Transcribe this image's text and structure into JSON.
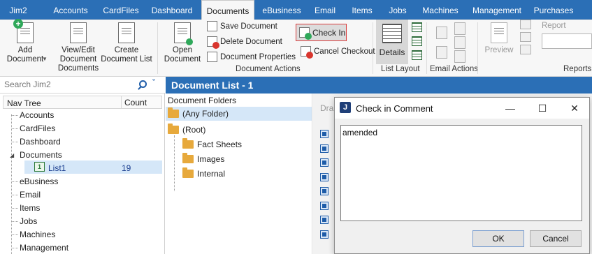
{
  "menubar": {
    "tabs": [
      {
        "label": "Jim2",
        "active": false
      },
      {
        "label": "Accounts",
        "active": false
      },
      {
        "label": "CardFiles",
        "active": false
      },
      {
        "label": "Dashboard",
        "active": false
      },
      {
        "label": "Documents",
        "active": true
      },
      {
        "label": "eBusiness",
        "active": false
      },
      {
        "label": "Email",
        "active": false
      },
      {
        "label": "Items",
        "active": false
      },
      {
        "label": "Jobs",
        "active": false
      },
      {
        "label": "Machines",
        "active": false
      },
      {
        "label": "Management",
        "active": false
      },
      {
        "label": "Purchases",
        "active": false
      }
    ]
  },
  "ribbon": {
    "add_document": "Add\nDocument",
    "view_edit": "View/Edit\nDocument\nDocuments",
    "create_list": "Create\nDocument List",
    "open_document": "Open\nDocument",
    "save_document": "Save Document",
    "delete_document": "Delete Document",
    "document_properties": "Document Properties",
    "check_in": "Check In",
    "cancel_checkout": "Cancel Checkout",
    "details": "Details",
    "preview": "Preview",
    "report": "Report",
    "groups": {
      "document_actions": "Document Actions",
      "list_layout": "List Layout",
      "email_actions": "Email Actions",
      "reports": "Reports"
    }
  },
  "search": {
    "placeholder": "Search Jim2"
  },
  "navtree": {
    "col_name": "Nav Tree",
    "col_count": "Count",
    "items": [
      {
        "label": "Accounts",
        "count": ""
      },
      {
        "label": "CardFiles",
        "count": ""
      },
      {
        "label": "Dashboard",
        "count": ""
      },
      {
        "label": "Documents",
        "count": ""
      },
      {
        "label": "List1",
        "count": "19"
      },
      {
        "label": "eBusiness",
        "count": ""
      },
      {
        "label": "Email",
        "count": ""
      },
      {
        "label": "Items",
        "count": ""
      },
      {
        "label": "Jobs",
        "count": ""
      },
      {
        "label": "Machines",
        "count": ""
      },
      {
        "label": "Management",
        "count": ""
      }
    ],
    "list_icon_text": "1"
  },
  "main": {
    "title": "Document List - 1",
    "folders_header": "Document Folders",
    "folders": [
      {
        "label": "(Any Folder)"
      },
      {
        "label": "(Root)"
      },
      {
        "label": "Fact Sheets"
      },
      {
        "label": "Images"
      },
      {
        "label": "Internal"
      }
    ],
    "drag_hint": "Dra"
  },
  "dialog": {
    "logo": "J",
    "title": "Check in Comment",
    "comment": "amended",
    "ok": "OK",
    "cancel": "Cancel",
    "minimize": "—",
    "maximize": "☐",
    "close": "✕"
  },
  "colors": {
    "accent": "#2b6fb6",
    "selection": "#d5e7f8",
    "highlight_border": "#d93a3a",
    "folder": "#e7a93c"
  }
}
